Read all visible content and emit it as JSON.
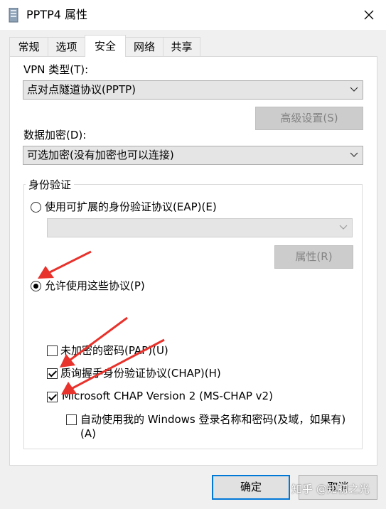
{
  "window": {
    "title": "PPTP4 属性",
    "close_icon": "close-icon"
  },
  "tabs": [
    {
      "label": "常规"
    },
    {
      "label": "选项"
    },
    {
      "label": "安全",
      "active": true
    },
    {
      "label": "网络"
    },
    {
      "label": "共享"
    }
  ],
  "security": {
    "vpn_type_label": "VPN 类型(T):",
    "vpn_type_value": "点对点隧道协议(PPTP)",
    "advanced_button": "高级设置(S)",
    "encryption_label": "数据加密(D):",
    "encryption_value": "可选加密(没有加密也可以连接)",
    "auth_group_title": "身份验证",
    "eap_radio_label": "使用可扩展的身份验证协议(EAP)(E)",
    "eap_radio_checked": false,
    "eap_combo_value": "",
    "properties_button": "属性(R)",
    "allow_radio_label": "允许使用这些协议(P)",
    "allow_radio_checked": true,
    "protocols": [
      {
        "label": "未加密的密码(PAP)(U)",
        "checked": false
      },
      {
        "label": "质询握手身份验证协议(CHAP)(H)",
        "checked": true
      },
      {
        "label": "Microsoft CHAP Version 2 (MS-CHAP v2)",
        "checked": true
      }
    ],
    "auto_windows_line1": "自动使用我的 Windows 登录名称和密码(及域，如果有)",
    "auto_windows_line2": "(A)",
    "auto_windows_checked": false
  },
  "footer": {
    "ok_button": "确定",
    "cancel_button": "取消"
  },
  "watermark": "知乎 @知初之光",
  "colors": {
    "accent": "#0078d7",
    "annotation_arrow": "#e8322c"
  }
}
